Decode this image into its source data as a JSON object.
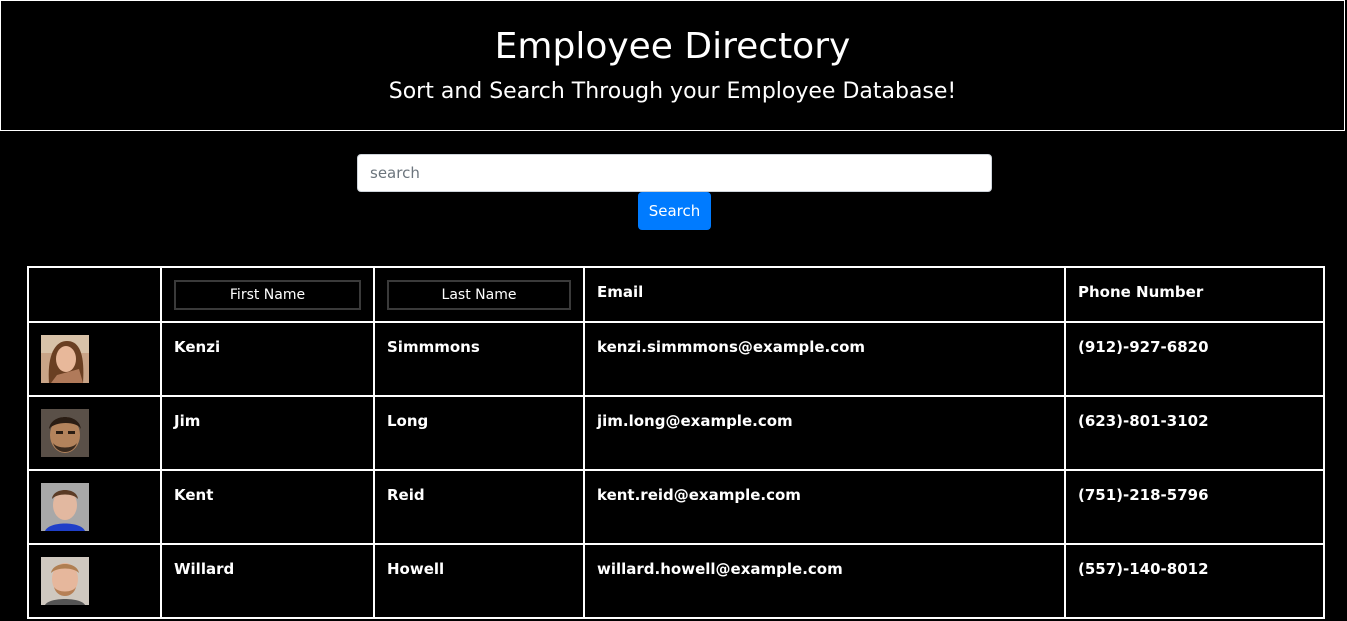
{
  "header": {
    "title": "Employee Directory",
    "subtitle": "Sort and Search Through your Employee Database!"
  },
  "search": {
    "placeholder": "search",
    "value": "",
    "button_label": "Search"
  },
  "table": {
    "columns": {
      "first_name": "First Name",
      "last_name": "Last Name",
      "email": "Email",
      "phone": "Phone Number"
    },
    "rows": [
      {
        "first": "Kenzi",
        "last": "Simmmons",
        "email": "kenzi.simmmons@example.com",
        "phone": "(912)-927-6820",
        "avatar": "woman-photo"
      },
      {
        "first": "Jim",
        "last": "Long",
        "email": "jim.long@example.com",
        "phone": "(623)-801-3102",
        "avatar": "man-photo"
      },
      {
        "first": "Kent",
        "last": "Reid",
        "email": "kent.reid@example.com",
        "phone": "(751)-218-5796",
        "avatar": "man-photo"
      },
      {
        "first": "Willard",
        "last": "Howell",
        "email": "willard.howell@example.com",
        "phone": "(557)-140-8012",
        "avatar": "man-photo"
      }
    ]
  },
  "colors": {
    "background": "#000000",
    "text": "#ffffff",
    "accent": "#007bff",
    "border": "#ffffff"
  }
}
